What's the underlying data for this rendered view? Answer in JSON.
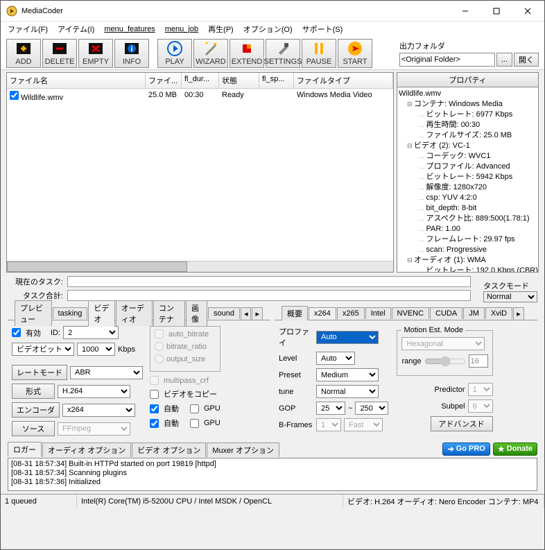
{
  "window": {
    "title": "MediaCoder"
  },
  "menubar": [
    "ファイル(F)",
    "アイテム(I)",
    "menu_features",
    "menu_job",
    "再生(P)",
    "オプション(O)",
    "サポート(S)"
  ],
  "toolbar": {
    "add": "ADD",
    "delete": "DELETE",
    "empty": "EMPTY",
    "info": "INFO",
    "play": "PLAY",
    "wizard": "WIZARD",
    "extend": "EXTEND",
    "settings": "SETTINGS",
    "pause": "PAUSE",
    "start": "START"
  },
  "output": {
    "label": "出力フォルダ",
    "value": "<Original Folder>",
    "browse": "...",
    "open": "開く"
  },
  "filelist": {
    "cols": {
      "name": "ファイル名",
      "size": "ファイ...",
      "dur": "fl_dur...",
      "state": "状態",
      "sp": "fl_sp...",
      "type": "ファイルタイプ"
    },
    "rows": [
      {
        "name": "Wildlife.wmv",
        "size": "25.0 MB",
        "dur": "00:30",
        "state": "Ready",
        "sp": "",
        "type": "Windows Media Video",
        "checked": true
      }
    ]
  },
  "properties": {
    "header": "プロパティ",
    "file": "Wildlife.wmv",
    "container": {
      "label": "コンテナ: Windows Media",
      "bitrate": "ビットレート: 6977 Kbps",
      "duration": "再生時間: 00:30",
      "filesize": "ファイルサイズ: 25.0 MB"
    },
    "video": {
      "label": "ビデオ (2): VC-1",
      "codec": "コーデック: WVC1",
      "profile": "プロファイル: Advanced",
      "bitrate": "ビットレート: 5942 Kbps",
      "res": "解像度: 1280x720",
      "csp": "csp: YUV 4:2:0",
      "depth": "bit_depth: 8-bit",
      "aspect": "アスペクト比: 889:500(1.78:1)",
      "par": "PAR: 1.00",
      "fps": "フレームレート: 29.97 fps",
      "scan": "scan: Progressive"
    },
    "audio": {
      "label": "オーディオ (1): WMA",
      "bitrate": "ビットレート: 192.0 Kbps (CBR)"
    }
  },
  "task": {
    "current": "現在のタスク:",
    "total": "タスク合計:",
    "modeLabel": "タスクモード",
    "mode": "Normal"
  },
  "leftTabs": {
    "items": [
      "プレビュー",
      "tasking",
      "ビデオ",
      "オーディオ",
      "コンテナ",
      "画像",
      "sound"
    ],
    "active": 2
  },
  "rightTabs": {
    "items": [
      "概要",
      "x264",
      "x265",
      "Intel",
      "NVENC",
      "CUDA",
      "JM",
      "XviD"
    ],
    "active": 1
  },
  "videoTab": {
    "enable": "有効",
    "idLabel": "ID:",
    "id": "2",
    "bitrateMode": "ビデオビットレー",
    "bitrate": "1000",
    "bitrateUnit": "Kbps",
    "auto_bitrate": "auto_bitrate",
    "bitrate_ratio": "bitrate_ratio",
    "output_size": "output_size",
    "rateMode": "レートモード",
    "rateModeVal": "ABR",
    "format": "形式",
    "formatVal": "H.264",
    "encoder": "エンコーダ",
    "encoderVal": "x264",
    "source": "ソース",
    "sourceVal": "FFmpeg",
    "multipass": "multipass_crf",
    "copyVideo": "ビデオをコピー",
    "auto": "自動",
    "gpu": "GPU"
  },
  "x264Tab": {
    "profile": "プロファイ",
    "profileVal": "Auto",
    "level": "Level",
    "levelVal": "Auto",
    "preset": "Preset",
    "presetVal": "Medium",
    "tune": "tune",
    "tuneVal": "Normal",
    "gop": "GOP",
    "gopMin": "25",
    "gopSep": "~",
    "gopMax": "250",
    "bframes": "B-Frames",
    "bframesN": "1",
    "bframesMode": "Fast",
    "meMode": "Motion Est. Mode",
    "meModeVal": "Hexagonal",
    "range": "range",
    "rangeVal": "16",
    "predictor": "Predictor",
    "predictorVal": "1",
    "subpel": "Subpel",
    "subpelVal": "6",
    "advanced": "アドバンスド"
  },
  "logTabs": [
    "ロガー",
    "オーディオ オプション",
    "ビデオ オプション",
    "Muxer オプション"
  ],
  "goPro": "Go PRO",
  "donate": "Donate",
  "log": [
    "[08-31 18:57:34] Built-in HTTPd started on port 19819 [httpd]",
    "[08-31 18:57:34] Scanning plugins",
    "[08-31 18:57:36] Initialized"
  ],
  "status": {
    "queued": "1 queued",
    "cpu": "Intel(R) Core(TM) i5-5200U CPU  / Intel MSDK / OpenCL",
    "summary": "ビデオ: H.264  オーディオ: Nero Encoder  コンテナ: MP4"
  }
}
